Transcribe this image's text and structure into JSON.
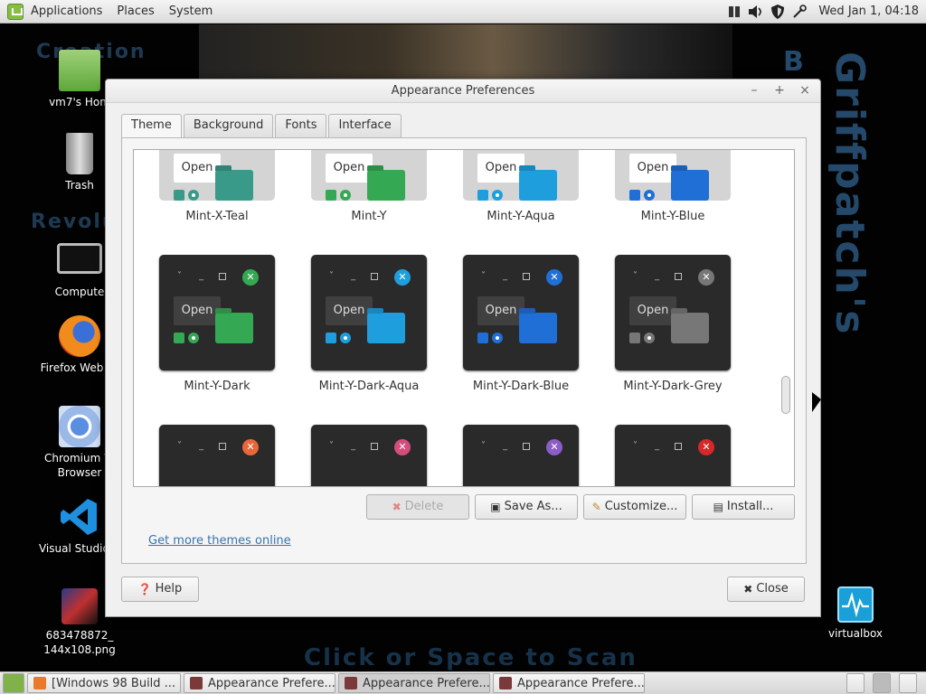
{
  "top_panel": {
    "menu": [
      "Applications",
      "Places",
      "System"
    ],
    "clock": "Wed Jan  1, 04:18"
  },
  "desktop": {
    "wall_text_left_1": "Creation",
    "wall_text_left_2": "Revolution",
    "wall_text_right_1": "Griffpatch's",
    "wall_text_right_2": "B",
    "wall_text_bottom": "Click or Space to Scan",
    "icons": [
      {
        "label": "vm7's Home",
        "display": "vm7's Hom"
      },
      {
        "label": "Trash",
        "display": "Trash"
      },
      {
        "label": "Computer",
        "display": "Compute"
      },
      {
        "label": "Firefox Web Browser",
        "display": "Firefox Web Br"
      },
      {
        "label": "Chromium Web Browser",
        "display_1": "Chromium W",
        "display_2": "Browser"
      },
      {
        "label": "Visual Studio Code",
        "display": "Visual Studio C"
      },
      {
        "label": "683478872_144x108.png",
        "display_1": "683478872_",
        "display_2": "144x108.png"
      },
      {
        "label": "virtualbox",
        "display": "virtualbox"
      }
    ]
  },
  "window": {
    "title": "Appearance Preferences",
    "tabs": [
      "Theme",
      "Background",
      "Fonts",
      "Interface"
    ],
    "active_tab": "Theme",
    "themes_row1": [
      {
        "name": "Mint-X-Teal",
        "open": "Open",
        "accent": "#3a9a8a",
        "style": "light"
      },
      {
        "name": "Mint-Y",
        "open": "Open",
        "accent": "#35a854",
        "style": "light"
      },
      {
        "name": "Mint-Y-Aqua",
        "open": "Open",
        "accent": "#1f9ede",
        "style": "light"
      },
      {
        "name": "Mint-Y-Blue",
        "open": "Open",
        "accent": "#1f6fd6",
        "style": "light"
      }
    ],
    "themes_row2": [
      {
        "name": "Mint-Y-Dark",
        "open": "Open",
        "accent": "#35a854",
        "style": "dark"
      },
      {
        "name": "Mint-Y-Dark-Aqua",
        "open": "Open",
        "accent": "#1f9ede",
        "style": "dark"
      },
      {
        "name": "Mint-Y-Dark-Blue",
        "open": "Open",
        "accent": "#1f6fd6",
        "style": "dark"
      },
      {
        "name": "Mint-Y-Dark-Grey",
        "open": "Open",
        "accent": "#777777",
        "style": "dark"
      }
    ],
    "themes_row3": [
      {
        "accent": "#e8673a",
        "style": "dark"
      },
      {
        "accent": "#d64c7c",
        "style": "dark"
      },
      {
        "accent": "#8c5cc8",
        "style": "dark"
      },
      {
        "accent": "#d62828",
        "style": "dark"
      }
    ],
    "buttons": {
      "delete": "Delete",
      "save_as": "Save As...",
      "customize": "Customize...",
      "install": "Install...",
      "help": "Help",
      "close": "Close"
    },
    "more_link": "Get more themes online"
  },
  "taskbar": {
    "items": [
      "[Windows 98 Build ...",
      "Appearance Prefere...",
      "Appearance Prefere...",
      "Appearance Prefere..."
    ]
  }
}
